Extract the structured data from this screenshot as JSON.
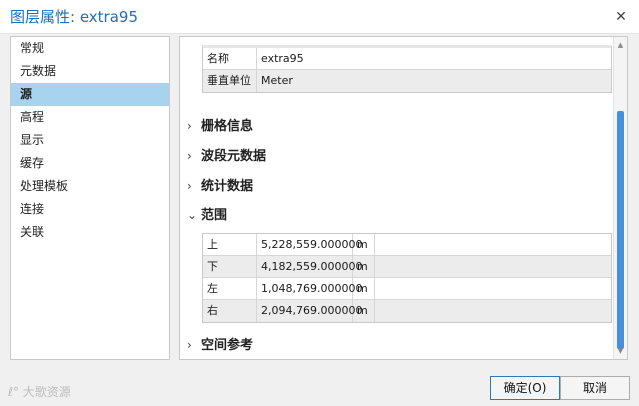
{
  "window": {
    "title": "图层属性: extra95",
    "close_glyph": "✕"
  },
  "sidebar": {
    "items": [
      {
        "label": "常规"
      },
      {
        "label": "元数据"
      },
      {
        "label": "源",
        "selected": true
      },
      {
        "label": "高程"
      },
      {
        "label": "显示"
      },
      {
        "label": "缓存"
      },
      {
        "label": "处理模板"
      },
      {
        "label": "连接"
      },
      {
        "label": "关联"
      }
    ]
  },
  "main": {
    "properties_rows": [
      {
        "name": "名称",
        "value": "extra95"
      },
      {
        "name": "垂直单位",
        "value": "Meter"
      }
    ],
    "sections": {
      "raster_info": "栅格信息",
      "band_metadata": "波段元数据",
      "statistics": "统计数据",
      "extent": "范围",
      "spatial_reference": "空间参考"
    },
    "section_states": {
      "raster_info": "collapsed",
      "band_metadata": "collapsed",
      "statistics": "collapsed",
      "extent": "expanded",
      "spatial_reference": "collapsed"
    },
    "chevrons": {
      "collapsed": "›",
      "expanded": "⌄"
    },
    "extent_rows": [
      {
        "side": "上",
        "value": "5,228,559.000000",
        "unit": "m"
      },
      {
        "side": "下",
        "value": "4,182,559.000000",
        "unit": "m"
      },
      {
        "side": "左",
        "value": "1,048,769.000000",
        "unit": "m"
      },
      {
        "side": "右",
        "value": "2,094,769.000000",
        "unit": "m"
      }
    ]
  },
  "scrollbar": {
    "up": "▲",
    "down": "▼"
  },
  "buttons": {
    "ok": "确定(O)",
    "cancel": "取消"
  },
  "watermark": "ℓ° 大歌资源",
  "colors": {
    "accent": "#1e6fb8",
    "selection": "#a8d3ef",
    "scroll_thumb": "#4a90d9"
  }
}
